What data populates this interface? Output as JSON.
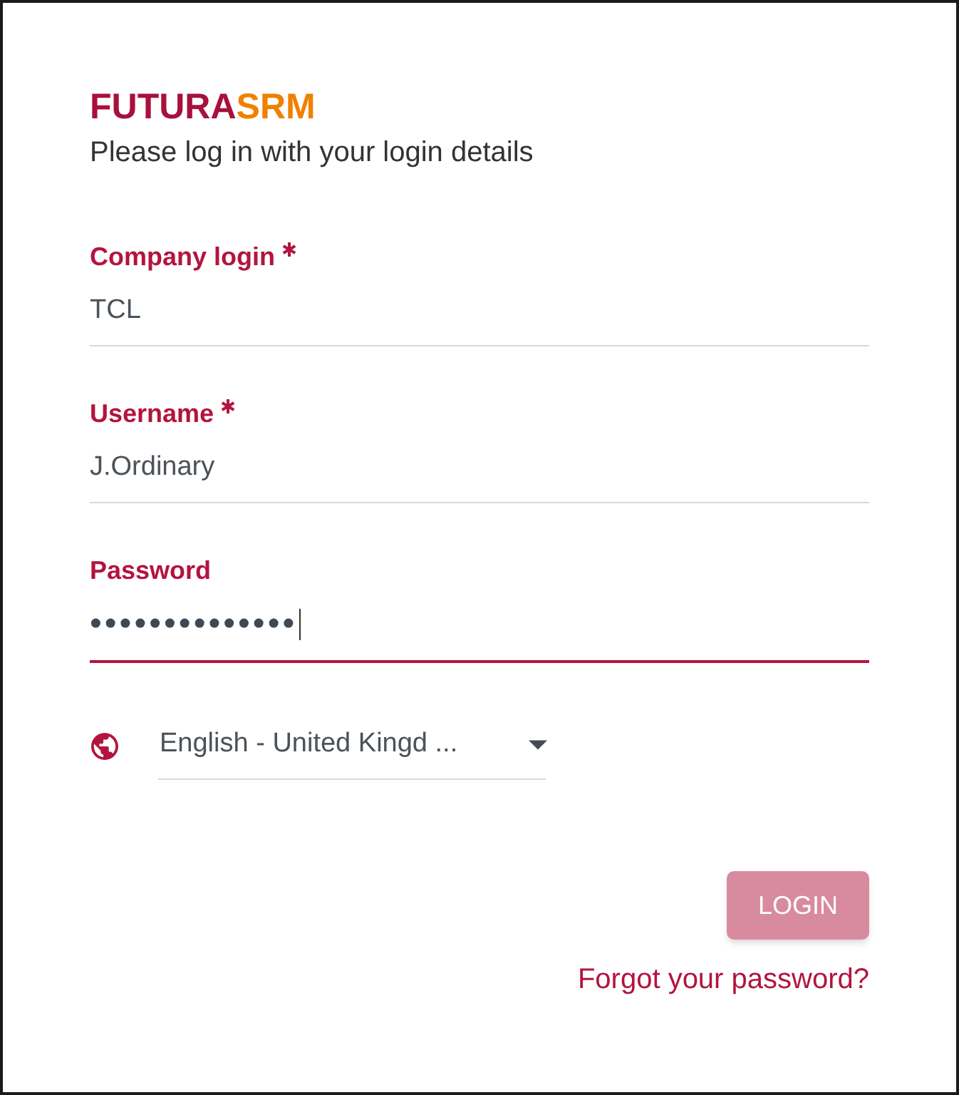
{
  "logo": [
    {
      "text": "FUTURA",
      "color": "#a8103e"
    },
    {
      "text": "SRM",
      "color": "#f08000"
    }
  ],
  "subtitle": "Please log in with your login details",
  "fields": [
    {
      "kind": "text",
      "label": "Company login",
      "required": true,
      "value": "TCL",
      "focused": false
    },
    {
      "kind": "text",
      "label": "Username",
      "required": true,
      "value": "J.Ordinary",
      "focused": false
    },
    {
      "kind": "password",
      "label": "Password",
      "required": false,
      "value": "••••••••••••••",
      "focused": true
    }
  ],
  "language_select": {
    "value": "English - United Kingd ..."
  },
  "login_button": {
    "label": "LOGIN",
    "disabled": true
  },
  "forgot_password_link": "Forgot your password?"
}
